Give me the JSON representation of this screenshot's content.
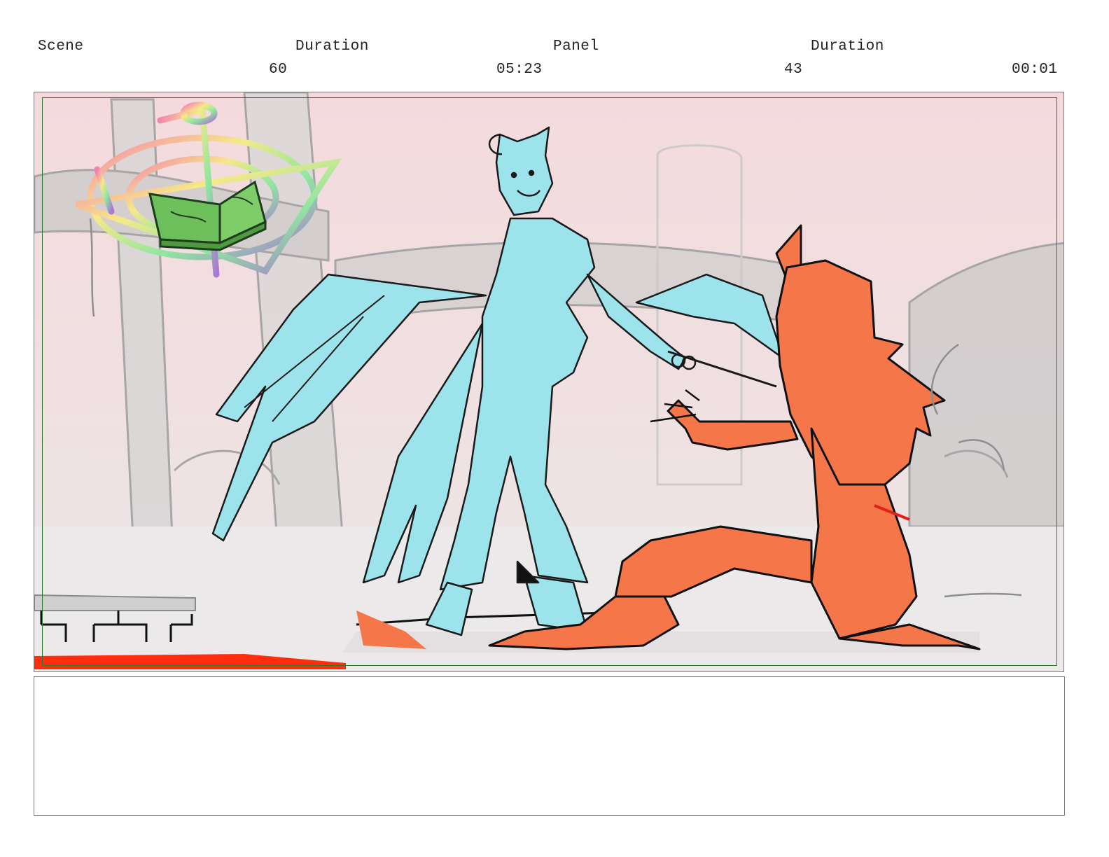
{
  "header": {
    "scene_label": "Scene",
    "scene_duration_label": "Duration",
    "panel_label": "Panel",
    "panel_duration_label": "Duration",
    "scene_number": "60",
    "scene_duration": "05:23",
    "panel_number": "43",
    "panel_duration": "00:01"
  },
  "colors": {
    "sky": "#f3dfe1",
    "angel": "#9de3ec",
    "demon": "#f47649",
    "book": "#6cbf5a",
    "safe_frame": "#2d7a2d",
    "floor_stripe": "#ff2d10"
  },
  "notes": {
    "text": ""
  }
}
